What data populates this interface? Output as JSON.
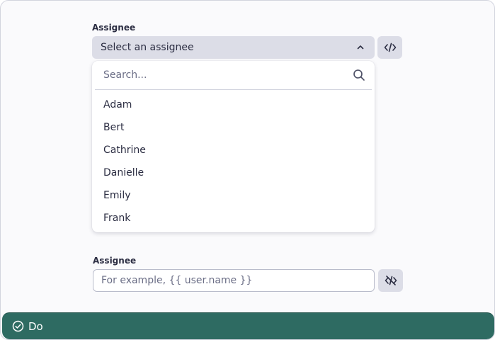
{
  "assignee_select": {
    "label": "Assignee",
    "value": "Select an assignee",
    "search_placeholder": "Search...",
    "options": [
      "Adam",
      "Bert",
      "Cathrine",
      "Danielle",
      "Emily",
      "Frank"
    ]
  },
  "assignee_text": {
    "label": "Assignee",
    "placeholder": "For example, {{ user.name }}"
  },
  "footer": {
    "action_label": "Do"
  },
  "colors": {
    "background": "#fafafc",
    "select_bg": "#dcdde7",
    "text": "#2b2d42",
    "footer_bg": "#2e6b62"
  },
  "icons": {
    "chevron": "chevron-up-icon",
    "code": "code-icon",
    "code_off": "code-off-icon",
    "search": "search-icon",
    "check": "check-circle-icon"
  }
}
